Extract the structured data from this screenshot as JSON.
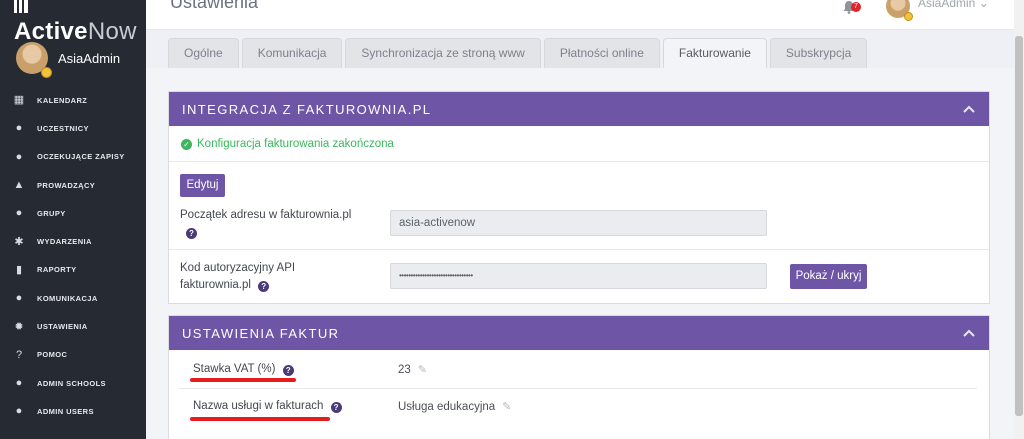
{
  "app": {
    "logo_main": "Active",
    "logo_accent": "Now",
    "user_name": "AsiaAdmin"
  },
  "sidebar": {
    "items": [
      {
        "label": "KALENDARZ",
        "icon": "calendar-icon",
        "glyph": "▦"
      },
      {
        "label": "UCZESTNICY",
        "icon": "user-icon",
        "glyph": "●"
      },
      {
        "label": "OCZEKUJĄCE ZAPISY",
        "icon": "user-pending-icon",
        "glyph": "●"
      },
      {
        "label": "PROWADZĄCY",
        "icon": "graduation-cap-icon",
        "glyph": "▲"
      },
      {
        "label": "GRUPY",
        "icon": "group-icon",
        "glyph": "●"
      },
      {
        "label": "WYDARZENIA",
        "icon": "events-icon",
        "glyph": "✱"
      },
      {
        "label": "RAPORTY",
        "icon": "chart-icon",
        "glyph": "▮"
      },
      {
        "label": "KOMUNIKACJA",
        "icon": "chat-icon",
        "glyph": "●"
      },
      {
        "label": "USTAWIENIA",
        "icon": "gear-icon",
        "glyph": "✹"
      },
      {
        "label": "POMOC",
        "icon": "help-icon",
        "glyph": "?"
      },
      {
        "label": "ADMIN SCHOOLS",
        "icon": "admin-schools-icon",
        "glyph": "●"
      },
      {
        "label": "ADMIN USERS",
        "icon": "admin-users-icon",
        "glyph": "●"
      }
    ]
  },
  "topbar": {
    "title": "Ustawienia",
    "notification_count": "7",
    "user_name": "AsiaAdmin"
  },
  "tabs": [
    {
      "label": "Ogólne"
    },
    {
      "label": "Komunikacja"
    },
    {
      "label": "Synchronizacja ze stroną www"
    },
    {
      "label": "Płatności online"
    },
    {
      "label": "Fakturowanie",
      "active": true
    },
    {
      "label": "Subskrypcja"
    }
  ],
  "integration": {
    "title": "INTEGRACJA Z FAKTUROWNIA.PL",
    "status": "Konfiguracja fakturowania zakończona",
    "edit_button": "Edytuj",
    "address_label": "Początek adresu w fakturownia.pl",
    "address_value": "asia-activenow",
    "api_label_line1": "Kod autoryzacyjny API",
    "api_label_line2": "fakturownia.pl",
    "api_value": "••••••••••••••••••••••••••••••••",
    "toggle_button": "Pokaż / ukryj"
  },
  "invoice": {
    "title": "USTAWIENIA FAKTUR",
    "vat_label": "Stawka VAT (%)",
    "vat_value": "23",
    "service_label": "Nazwa usługi w fakturach",
    "service_value": "Usługa edukacyjna"
  },
  "colors": {
    "sidebar": "#252a33",
    "accent": "#6f55a6",
    "success": "#3bb75d",
    "highlight": "#e41c1c"
  }
}
